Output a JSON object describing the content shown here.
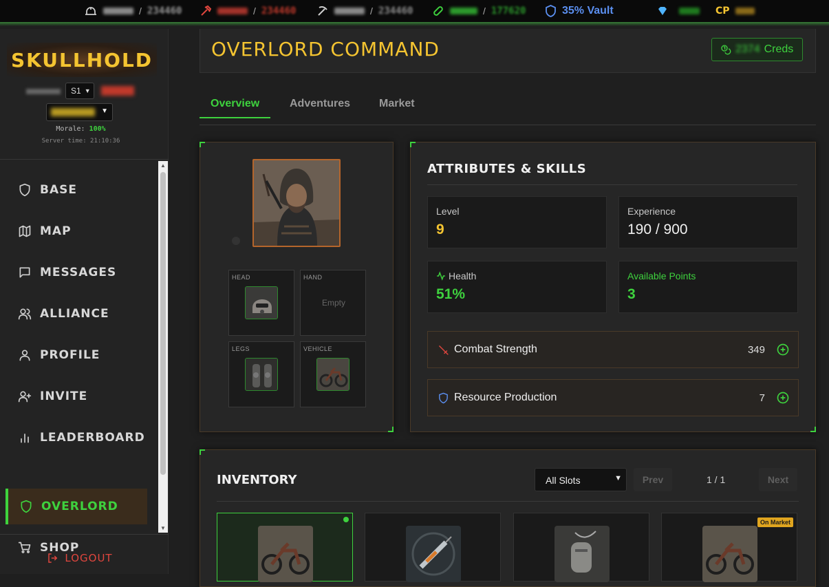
{
  "topbar": {
    "resources": [
      {
        "icon": "helmet-icon",
        "max": "234460"
      },
      {
        "icon": "hammer-icon",
        "max": "234460"
      },
      {
        "icon": "pickaxe-icon",
        "max": "234460"
      },
      {
        "icon": "bandage-icon",
        "max": "177620"
      }
    ],
    "vault": "35% Vault",
    "gem_icon": "gem-icon",
    "cp_label": "CP"
  },
  "sidebar": {
    "brand": "SKULLHOLD",
    "season_select": "S1",
    "morale_label": "Morale:",
    "morale_value": "100%",
    "server_time": "Server time: 21:10:36",
    "items": [
      {
        "label": "BASE",
        "icon": "shield-icon"
      },
      {
        "label": "MAP",
        "icon": "map-icon"
      },
      {
        "label": "MESSAGES",
        "icon": "message-icon"
      },
      {
        "label": "ALLIANCE",
        "icon": "users-icon"
      },
      {
        "label": "PROFILE",
        "icon": "user-icon"
      },
      {
        "label": "INVITE",
        "icon": "user-plus-icon"
      },
      {
        "label": "LEADERBOARD",
        "icon": "bar-chart-icon"
      },
      {
        "label": "OVERLORD",
        "icon": "shield-icon",
        "active": true
      },
      {
        "label": "SHOP",
        "icon": "cart-icon"
      }
    ],
    "logout": "LOGOUT"
  },
  "header": {
    "title": "OVERLORD COMMAND",
    "creds_label": "Creds",
    "creds_value": "2374"
  },
  "tabs": [
    "Overview",
    "Adventures",
    "Market"
  ],
  "equipment": {
    "slots": [
      {
        "label": "HEAD",
        "empty": false
      },
      {
        "label": "HAND",
        "empty": true,
        "empty_text": "Empty"
      },
      {
        "label": "LEGS",
        "empty": false
      },
      {
        "label": "VEHICLE",
        "empty": false
      }
    ]
  },
  "attributes": {
    "title": "ATTRIBUTES & SKILLS",
    "level_label": "Level",
    "level_value": "9",
    "experience_label": "Experience",
    "experience_value": "190 / 900",
    "health_label": "Health",
    "health_value": "51%",
    "points_label": "Available Points",
    "points_value": "3",
    "skills": [
      {
        "name": "Combat Strength",
        "value": "349",
        "icon": "sword-icon"
      },
      {
        "name": "Resource Production",
        "value": "7",
        "icon": "shield-icon"
      }
    ]
  },
  "inventory": {
    "title": "INVENTORY",
    "filter": "All Slots",
    "prev": "Prev",
    "next": "Next",
    "page": "1 / 1",
    "badge": "On Market"
  },
  "colors": {
    "accent_green": "#3ed23e",
    "gold": "#f4c431",
    "vault_blue": "#5b8ff0",
    "logout_red": "#e0463e"
  }
}
